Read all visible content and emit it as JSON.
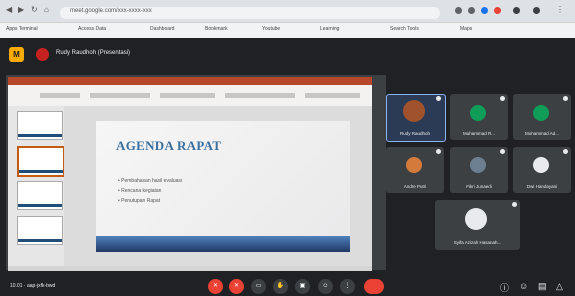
{
  "browser": {
    "url": "meet.google.com/xxx-xxxx-xxx",
    "bookmarks": [
      "Apps Terminal",
      "Access Data",
      "Dashboard",
      "Bookmark",
      "Youtube",
      "Learning",
      "Search Tools",
      "Maps"
    ]
  },
  "meet": {
    "presenter_title": "Rudy Raudhoh (Presentasi)",
    "time_meeting": "10.01 · aap-jxfk-bwd"
  },
  "slide": {
    "title": "AGENDA RAPAT",
    "bullets": [
      "• Pembahasan hasil evaluasi",
      "• Rencana kegiatan",
      "• Penutupan Rapat"
    ]
  },
  "participants": [
    {
      "name": "Rudy Raudhoh",
      "color": "#a0522d"
    },
    {
      "name": "Muhammad R...",
      "color": "#0f9d58"
    },
    {
      "name": "Muhammad Ad...",
      "color": "#0f9d58"
    },
    {
      "name": "Andre Putri",
      "color": "#d47b3b"
    },
    {
      "name": "Fikri Junaedi",
      "color": "#6b7f91"
    },
    {
      "name": "Dwi Handayani",
      "color": "#e8eaed"
    },
    {
      "name": "Syifa Azizah Hasanah...",
      "color": "#e8eaed"
    }
  ],
  "colors": {
    "accent": "#8ab4f8",
    "end_call": "#ea4335",
    "meet_logo": "#f9ab00"
  }
}
